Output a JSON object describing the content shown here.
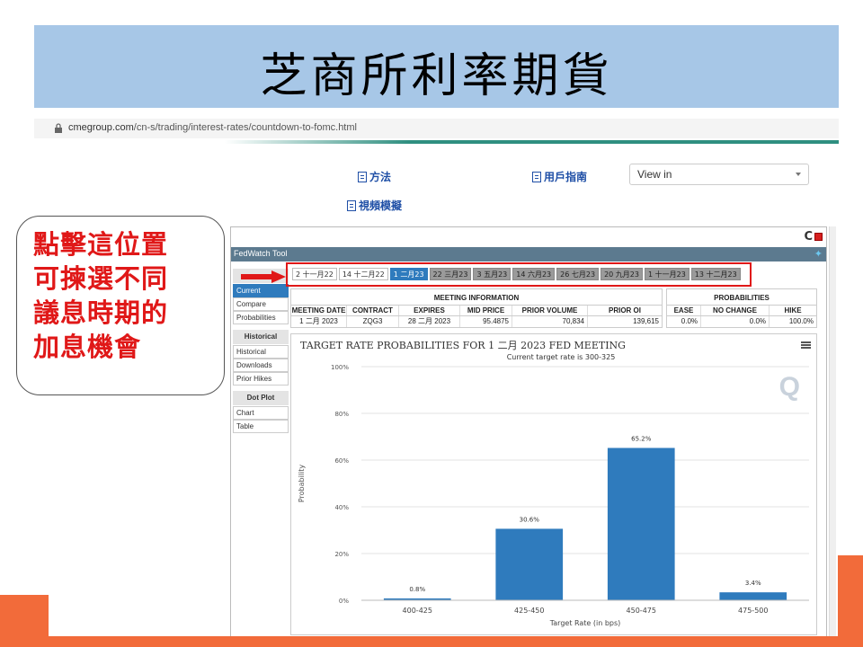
{
  "slide": {
    "title": "芝商所利率期貨",
    "callout_lines": [
      "點擊這位置",
      "可揀選不同",
      "議息時期的",
      "加息機會"
    ]
  },
  "browser": {
    "url_domain": "cmegroup.com",
    "url_path": "/cn-s/trading/interest-rates/countdown-to-fomc.html"
  },
  "page": {
    "links": {
      "method": "方法",
      "user_guide": "用戶指南",
      "video": "視頻模擬"
    },
    "view_in_select": "View in"
  },
  "widget": {
    "tool_name": "FedWatch Tool",
    "nav": {
      "section_current": [
        {
          "label": "Current",
          "active": true
        },
        {
          "label": "Compare",
          "active": false
        },
        {
          "label": "Probabilities",
          "active": false
        }
      ],
      "historical_heading": "Historical",
      "section_historical": [
        "Historical",
        "Downloads",
        "Prior Hikes"
      ],
      "dotplot_heading": "Dot Plot",
      "section_dotplot": [
        "Chart",
        "Table"
      ]
    },
    "tabs": [
      {
        "label": "2 十一月22",
        "state": "normal"
      },
      {
        "label": "14 十二月22",
        "state": "normal"
      },
      {
        "label": "1 二月23",
        "state": "selected"
      },
      {
        "label": "22 三月23",
        "state": "grey"
      },
      {
        "label": "3 五月23",
        "state": "grey"
      },
      {
        "label": "14 六月23",
        "state": "grey"
      },
      {
        "label": "26 七月23",
        "state": "grey"
      },
      {
        "label": "20 九月23",
        "state": "grey"
      },
      {
        "label": "1 十一月23",
        "state": "grey"
      },
      {
        "label": "13 十二月23",
        "state": "grey"
      }
    ],
    "meeting_info": {
      "heading": "MEETING INFORMATION",
      "columns": [
        "MEETING DATE",
        "CONTRACT",
        "EXPIRES",
        "MID PRICE",
        "PRIOR VOLUME",
        "PRIOR OI"
      ],
      "row": [
        "1 二月 2023",
        "ZQG3",
        "28 二月 2023",
        "95.4875",
        "70,834",
        "139,615"
      ]
    },
    "probabilities": {
      "heading": "PROBABILITIES",
      "columns": [
        "EASE",
        "NO CHANGE",
        "HIKE"
      ],
      "row": [
        "0.0%",
        "0.0%",
        "100.0%"
      ]
    },
    "chart_title": "TARGET RATE PROBABILITIES FOR 1 二月 2023 FED MEETING",
    "watermark": "Q"
  },
  "chart_data": {
    "type": "bar",
    "title": "TARGET RATE PROBABILITIES FOR 1 二月 2023 FED MEETING",
    "subtitle": "Current target rate is 300-325",
    "categories": [
      "400-425",
      "425-450",
      "450-475",
      "475-500"
    ],
    "values": [
      0.8,
      30.6,
      65.2,
      3.4
    ],
    "data_labels": [
      "0.8%",
      "30.6%",
      "65.2%",
      "3.4%"
    ],
    "xlabel": "Target Rate (in bps)",
    "ylabel": "Probability",
    "ylim": [
      0,
      100
    ],
    "yticks": [
      0,
      20,
      40,
      60,
      80,
      100
    ],
    "ytick_labels": [
      "0%",
      "20%",
      "40%",
      "60%",
      "80%",
      "100%"
    ],
    "bar_color": "#2f7bbd",
    "grid": true,
    "legend": "none"
  }
}
